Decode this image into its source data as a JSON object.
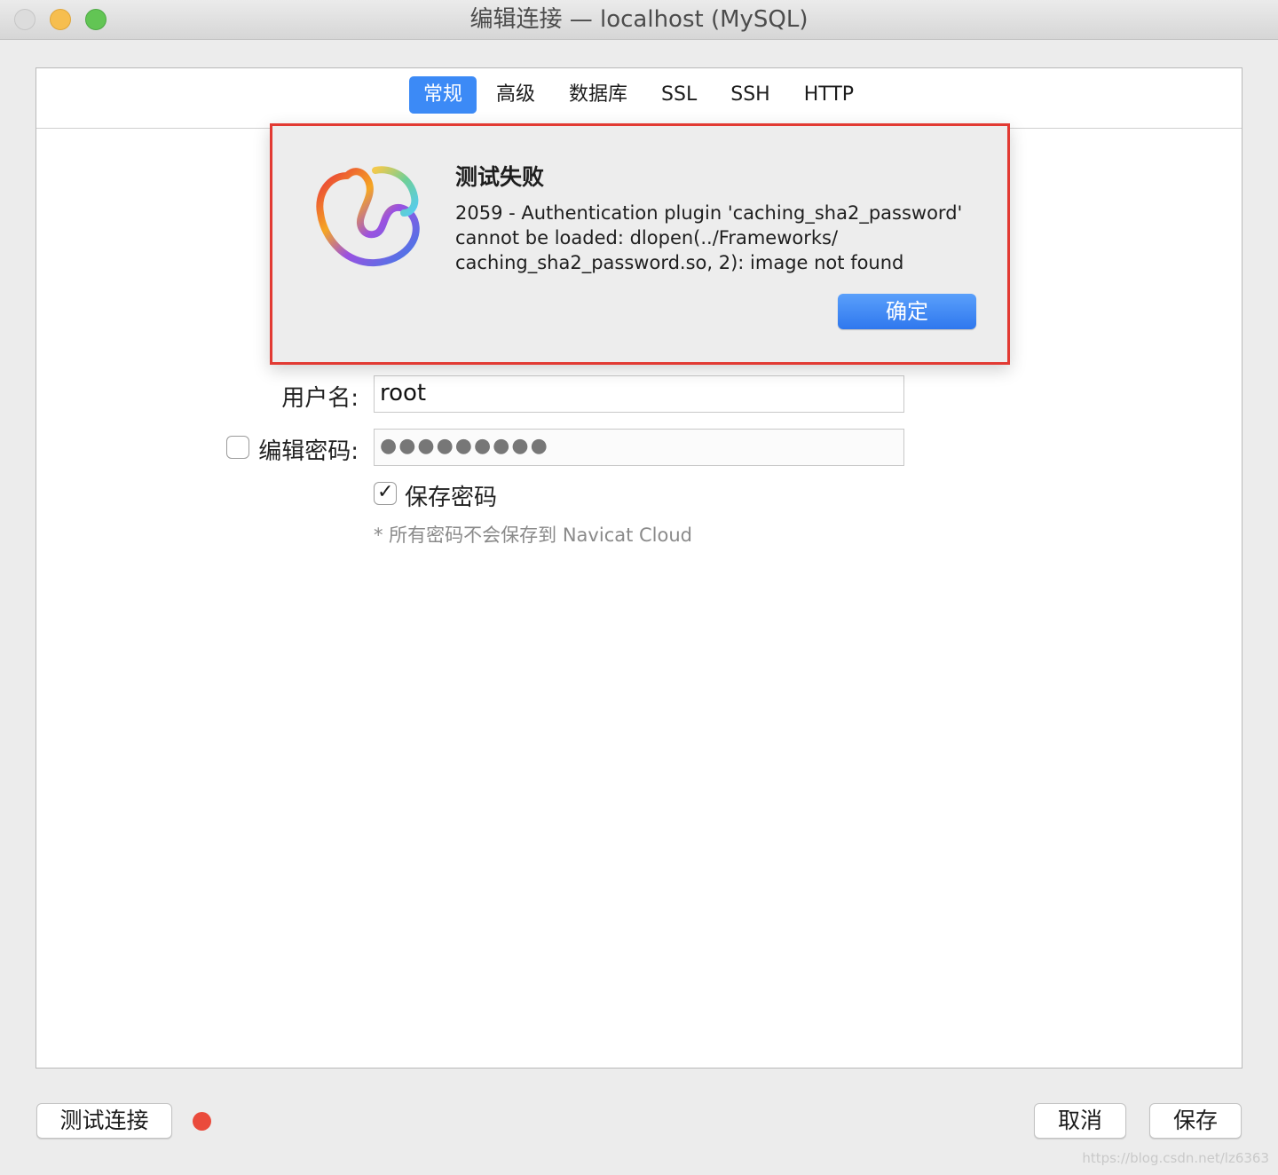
{
  "window": {
    "title": "编辑连接 — localhost (MySQL)"
  },
  "tabs": [
    {
      "label": "常规",
      "active": true
    },
    {
      "label": "高级",
      "active": false
    },
    {
      "label": "数据库",
      "active": false
    },
    {
      "label": "SSL",
      "active": false
    },
    {
      "label": "SSH",
      "active": false
    },
    {
      "label": "HTTP",
      "active": false
    }
  ],
  "alert": {
    "title": "测试失败",
    "message_lines": [
      "2059 - Authentication plugin 'caching_sha2_password'",
      "cannot be loaded: dlopen(../Frameworks/",
      "caching_sha2_password.so, 2): image not found"
    ],
    "ok_label": "确定",
    "icon": "navicat-logo-icon",
    "border_color": "#e23a33"
  },
  "form": {
    "username_label": "用户名:",
    "username_value": "root",
    "edit_password_label": "编辑密码:",
    "edit_password_checked": false,
    "password_value": "●●●●●●●●●",
    "save_password_label": "保存密码",
    "save_password_checked": true,
    "note": "* 所有密码不会保存到 Navicat Cloud"
  },
  "footer": {
    "test_connection_label": "测试连接",
    "status_color": "#ea4b3c",
    "cancel_label": "取消",
    "save_label": "保存"
  },
  "watermark": "https://blog.csdn.net/lz6363",
  "colors": {
    "accent": "#3c8af6"
  }
}
